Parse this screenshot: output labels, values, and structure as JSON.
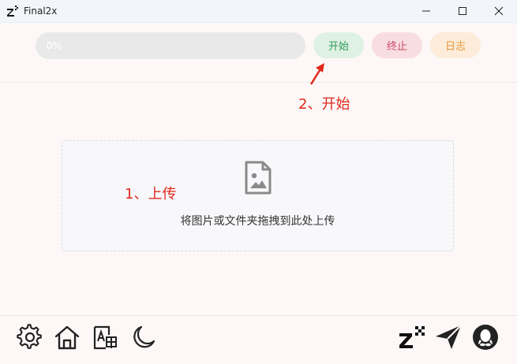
{
  "window": {
    "title": "Final2x",
    "controls": [
      "minimize-icon",
      "maximize-icon",
      "close-icon"
    ]
  },
  "toolbar": {
    "progress_text": "0%",
    "progress_value": 0,
    "start_label": "开始",
    "stop_label": "终止",
    "log_label": "日志"
  },
  "annotations": {
    "step2": "2、开始",
    "step1": "1、上传"
  },
  "upload": {
    "hint": "将图片或文件夹拖拽到此处上传",
    "icon": "image-file-icon"
  },
  "footer": {
    "left_icons": [
      "gear-icon",
      "home-icon",
      "image-text-icon",
      "moon-icon"
    ],
    "right_icons": [
      "final2x-logo-icon",
      "send-icon",
      "qq-icon"
    ]
  },
  "colors": {
    "annotation": "#e0281b",
    "start_bg": "#dff1e4",
    "start_fg": "#2f9c57",
    "stop_bg": "#f8dde2",
    "stop_fg": "#c74a63",
    "log_bg": "#fcecd9",
    "log_fg": "#e3983b"
  }
}
